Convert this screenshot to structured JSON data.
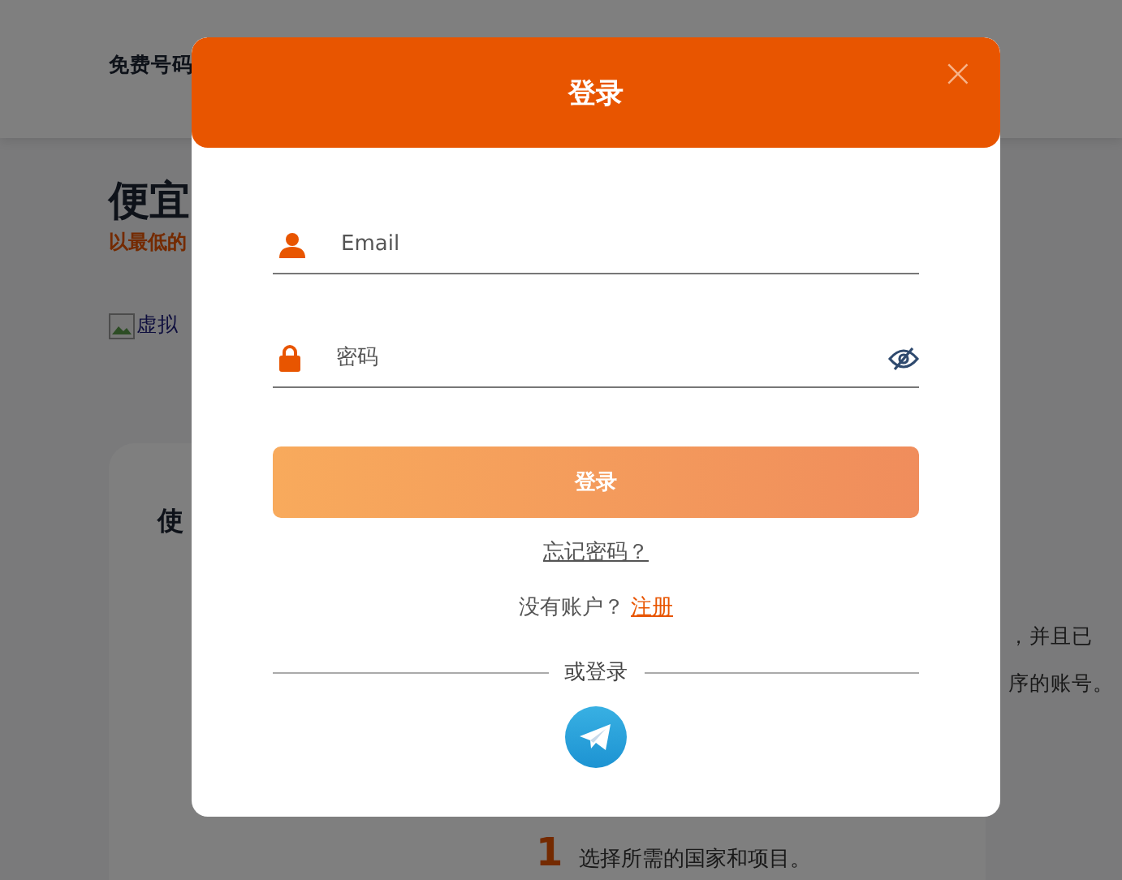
{
  "page": {
    "nav_item": "免费号码",
    "hero_title": "便宜",
    "hero_subtitle": "以最低的",
    "image_alt": "虚拟",
    "card_title": "使",
    "text_lines": [
      "，并且已",
      "序的账号。"
    ],
    "step": {
      "number": "1",
      "text": "选择所需的国家和项目。"
    }
  },
  "modal": {
    "title": "登录",
    "close": "×",
    "fields": [
      {
        "kind": "email",
        "placeholder": "Email"
      },
      {
        "kind": "password",
        "placeholder": "密码"
      }
    ],
    "submit": "登录",
    "forgot": "忘记密码？",
    "signup_prompt": "没有账户？",
    "signup_link": "注册",
    "divider": "或登录"
  }
}
